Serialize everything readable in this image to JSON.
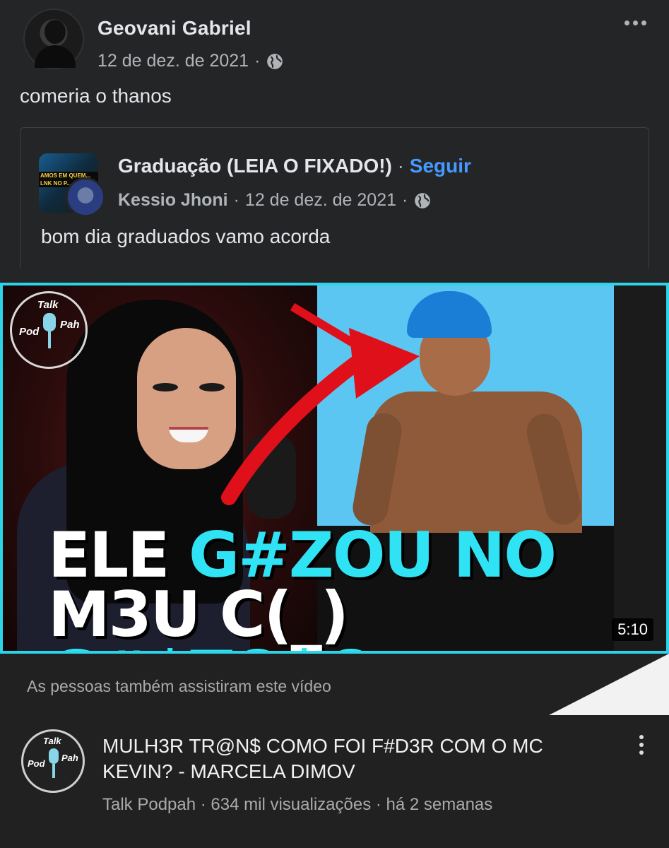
{
  "post": {
    "author": "Geovani Gabriel",
    "date": "12 de dez. de 2021",
    "separator": "·",
    "text": "comeria o thanos",
    "privacy_icon": "globe-icon",
    "more_icon": "more-horizontal-icon"
  },
  "shared_post": {
    "group_name": "Graduação (LEIA O FIXADO!)",
    "separator": "·",
    "follow_label": "Seguir",
    "author": "Kessio Jhoni",
    "date": "12 de dez. de 2021",
    "text": "bom dia graduados vamo acorda",
    "group_avatar_text": "AMOS EM QUEM... LNK NO P...",
    "privacy_icon": "globe-icon"
  },
  "video": {
    "logo_text": [
      "Talk",
      "Pod",
      "Pah"
    ],
    "headline_line1_white": "ELE",
    "headline_line1_cyan": "G#ZOU NO",
    "headline_line2_white": "M3U C(_)",
    "headline_line2_cyan": "G#$TO$O",
    "duration": "5:10",
    "also_watched": "As pessoas também assistiram este vídeo"
  },
  "youtube": {
    "title": "MULH3R TR@N$ COMO FOI F#D3R COM O MC KEVIN? - MARCELA DIMOV",
    "meta": "Talk Podpah · 634 mil visualizações · há 2 semanas",
    "menu_icon": "more-vertical-icon"
  },
  "colors": {
    "background": "#242526",
    "accent_link": "#4599ff",
    "thumb_border": "#2bd4e6",
    "headline_cyan": "#2fe3f5"
  }
}
